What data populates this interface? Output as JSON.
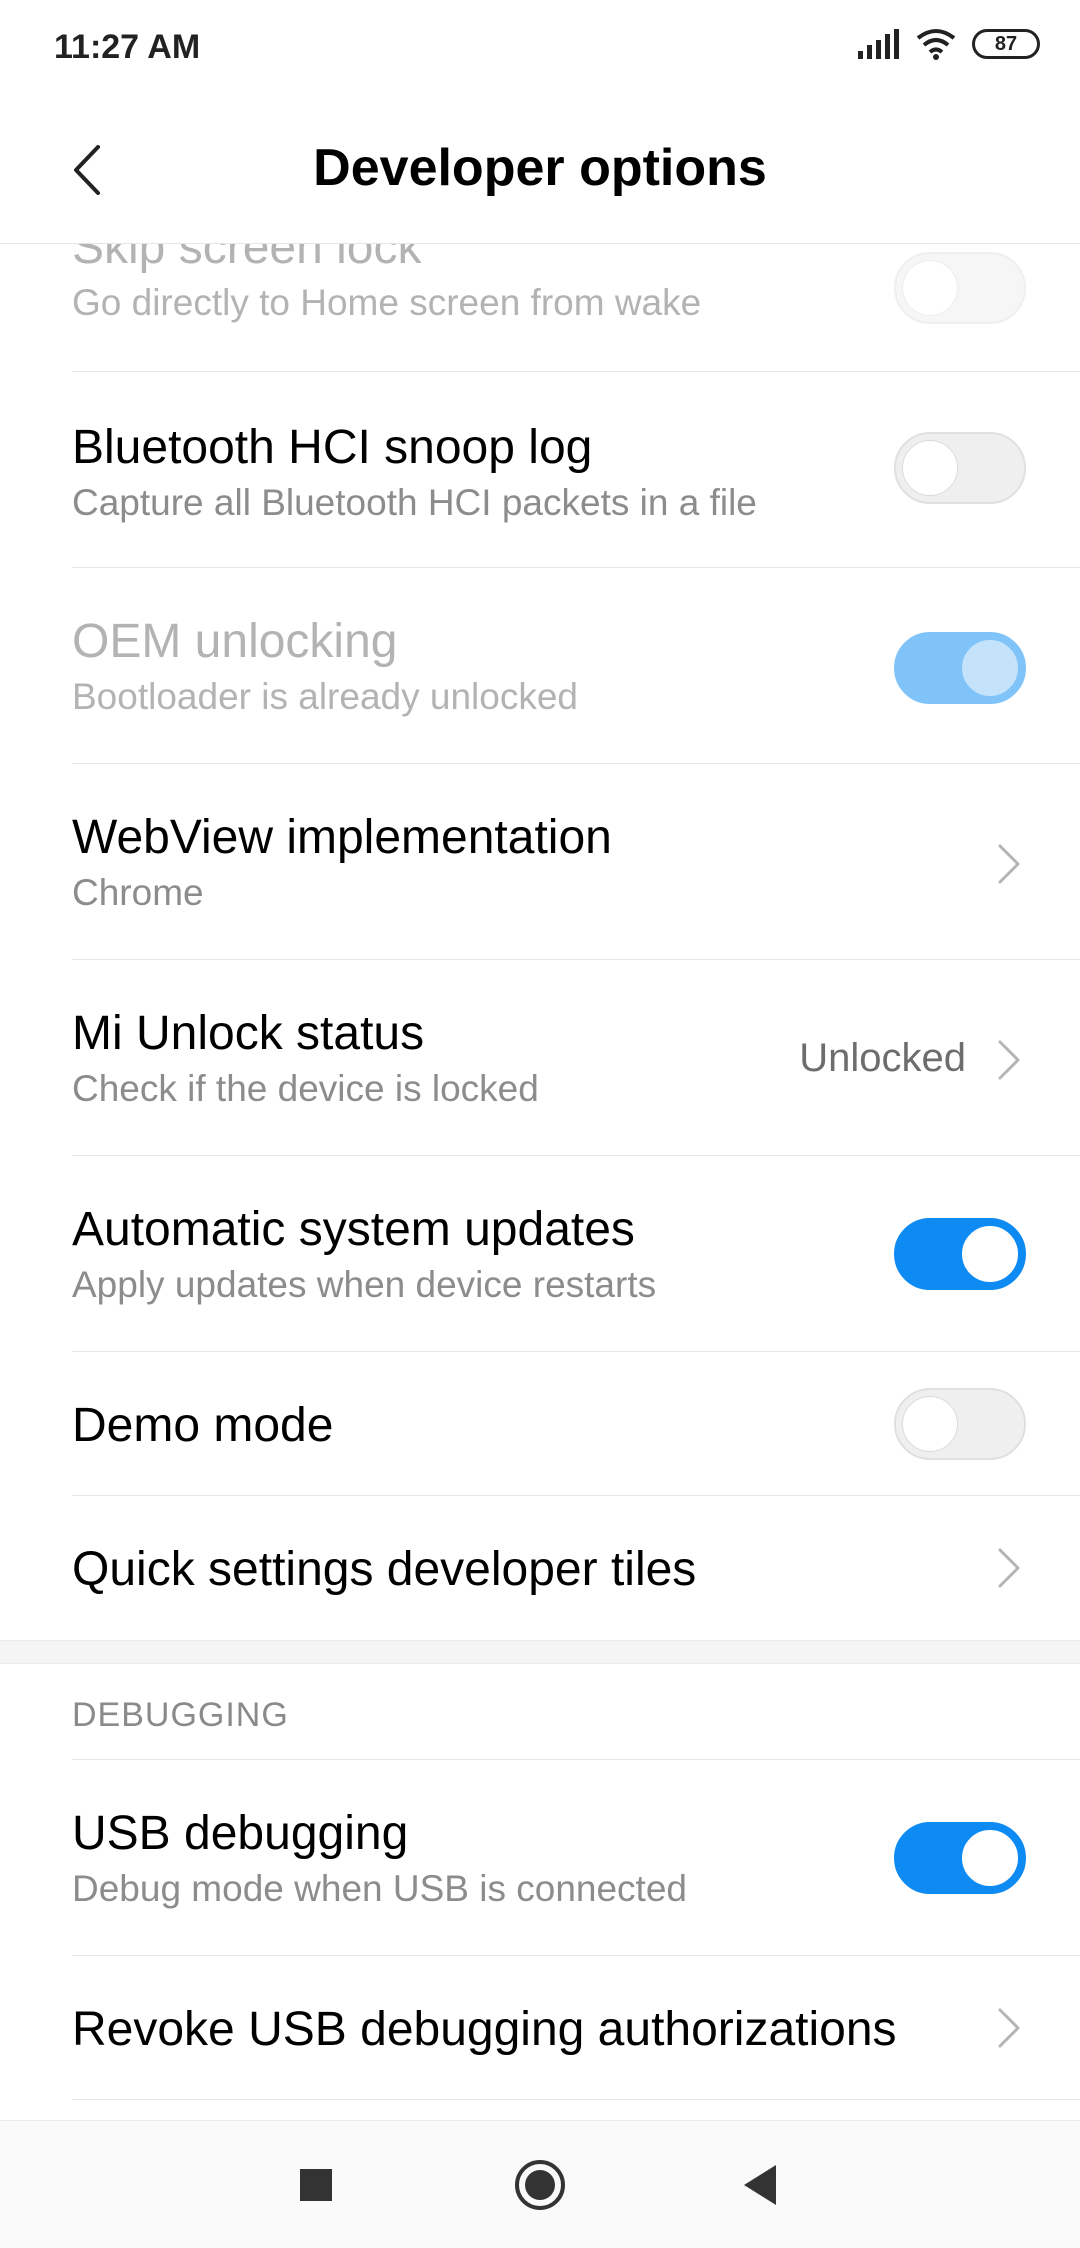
{
  "status_bar": {
    "time": "11:27 AM",
    "battery": "87"
  },
  "header": {
    "title": "Developer options"
  },
  "settings": [
    {
      "title": "Skip screen lock",
      "subtitle": "Go directly to Home screen from wake"
    },
    {
      "title": "Bluetooth HCI snoop log",
      "subtitle": "Capture all Bluetooth HCI packets in a file"
    },
    {
      "title": "OEM unlocking",
      "subtitle": "Bootloader is already unlocked"
    },
    {
      "title": "WebView implementation",
      "subtitle": "Chrome"
    },
    {
      "title": "Mi Unlock status",
      "subtitle": "Check if the device is locked",
      "value": "Unlocked"
    },
    {
      "title": "Automatic system updates",
      "subtitle": "Apply updates when device restarts"
    },
    {
      "title": "Demo mode"
    },
    {
      "title": "Quick settings developer tiles"
    }
  ],
  "debugging": {
    "header": "DEBUGGING",
    "items": [
      {
        "title": "USB debugging",
        "subtitle": "Debug mode when USB is connected"
      },
      {
        "title": "Revoke USB debugging authorizations"
      }
    ]
  },
  "toggles": {
    "skip_screen_lock": "off",
    "bluetooth_hci_snoop_log": "off",
    "oem_unlocking": "on",
    "automatic_system_updates": "on",
    "demo_mode": "off",
    "usb_debugging": "on"
  },
  "colors": {
    "accent": "#0d8bf2",
    "accent_disabled": "#7fc3f9",
    "subtitle": "#8c8c8c"
  }
}
